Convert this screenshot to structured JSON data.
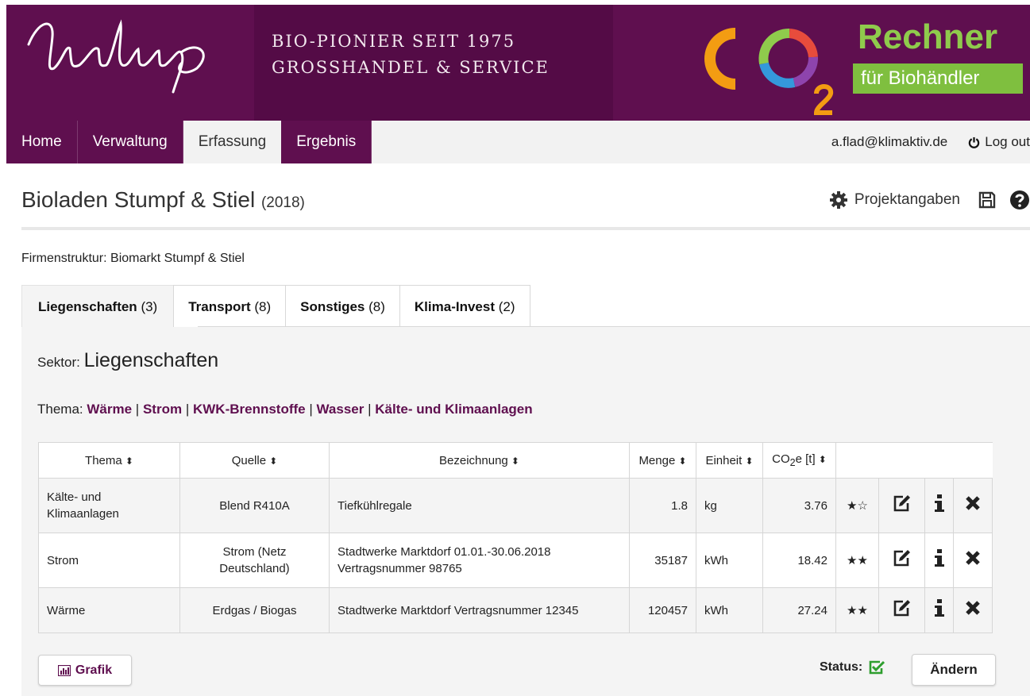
{
  "brand": {
    "tagline_line1": "BIO-PIONIER SEIT 1975",
    "tagline_line2": "GROSSHANDEL & SERVICE",
    "co2_title": "Rechner",
    "co2_subtitle": "für Biohändler",
    "colors": {
      "banner": "#5f0f4f",
      "accent_green": "#7fbf3f",
      "link_purple": "#5f0f4f"
    }
  },
  "nav": {
    "items": [
      {
        "label": "Home",
        "active": false
      },
      {
        "label": "Verwaltung",
        "active": false
      },
      {
        "label": "Erfassung",
        "active": true
      },
      {
        "label": "Ergebnis",
        "active": false
      }
    ],
    "user_email": "a.flad@klimaktiv.de",
    "logout_label": "Log out"
  },
  "page": {
    "title": "Bioladen Stumpf & Stiel",
    "year": "(2018)",
    "projekt_label": "Projektangaben",
    "icons": [
      "gear-icon",
      "save-icon",
      "help-icon"
    ]
  },
  "firmenstruktur": {
    "label": "Firmenstruktur:",
    "value": "Biomarkt Stumpf & Stiel"
  },
  "tabs": [
    {
      "label": "Liegenschaften",
      "count": "(3)",
      "active": true
    },
    {
      "label": "Transport",
      "count": "(8)",
      "active": false
    },
    {
      "label": "Sonstiges",
      "count": "(8)",
      "active": false
    },
    {
      "label": "Klima-Invest",
      "count": "(2)",
      "active": false
    }
  ],
  "sektor": {
    "label": "Sektor:",
    "value": "Liegenschaften"
  },
  "thema": {
    "label": "Thema:",
    "links": [
      "Wärme",
      "Strom",
      "KWK-Brennstoffe",
      "Wasser",
      "Kälte- und Klimaanlagen"
    ],
    "separator": "|"
  },
  "table": {
    "headers": [
      "Thema",
      "Quelle",
      "Bezeichnung",
      "Menge",
      "Einheit",
      "CO2e [t]"
    ],
    "co2_header_parts": {
      "pre": "CO",
      "sub": "2",
      "post": "e [t]"
    },
    "sort_glyph": "⬍",
    "rows": [
      {
        "thema": "Kälte- und Klimaanlagen",
        "quelle": "Blend R410A",
        "bezeichnung": "Tiefkühlregale",
        "menge": "1.8",
        "einheit": "kg",
        "co2e": "3.76",
        "rating": "★☆"
      },
      {
        "thema": "Strom",
        "quelle": "Strom (Netz Deutschland)",
        "bezeichnung": "Stadtwerke Marktdorf 01.01.-30.06.2018 Vertragsnummer 98765",
        "menge": "35187",
        "einheit": "kWh",
        "co2e": "18.42",
        "rating": "★★"
      },
      {
        "thema": "Wärme",
        "quelle": "Erdgas / Biogas",
        "bezeichnung": "Stadtwerke Marktdorf Vertragsnummer 12345",
        "menge": "120457",
        "einheit": "kWh",
        "co2e": "27.24",
        "rating": "★★"
      }
    ]
  },
  "footer": {
    "grafik_label": "Grafik",
    "status_label": "Status:",
    "status_ok": true,
    "aendern_label": "Ändern"
  }
}
